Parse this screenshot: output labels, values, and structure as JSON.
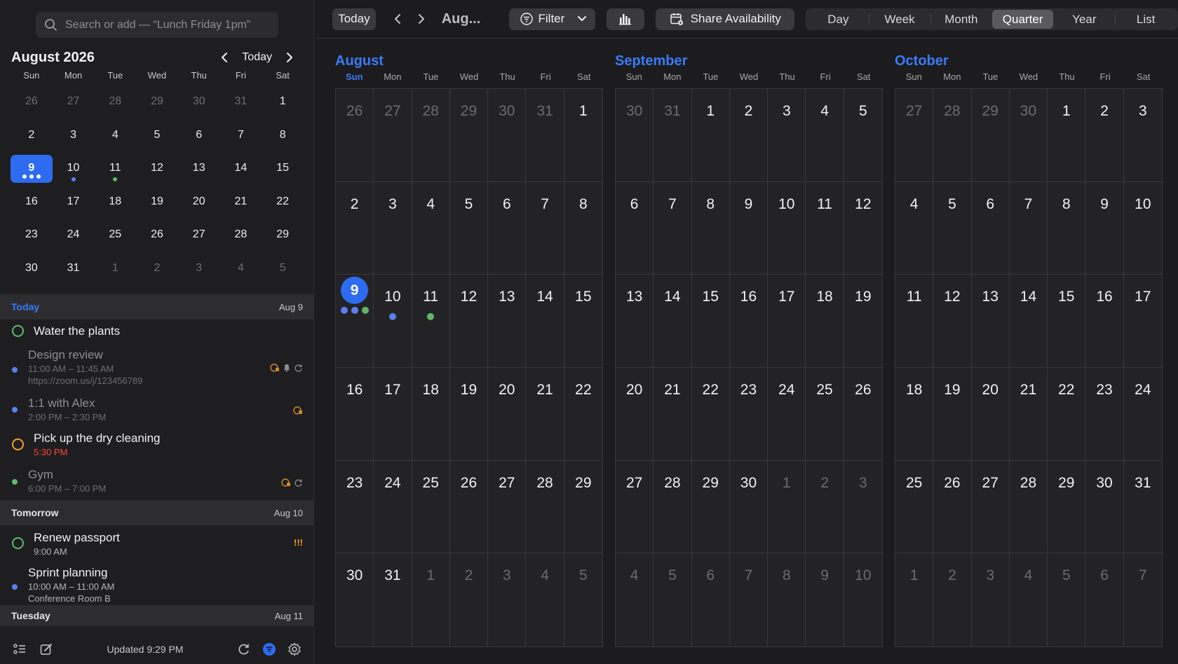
{
  "search": {
    "placeholder": "Search or add — “Lunch Friday 1pm”"
  },
  "mini": {
    "title": "August 2026",
    "today_label": "Today",
    "dow": [
      "Sun",
      "Mon",
      "Tue",
      "Wed",
      "Thu",
      "Fri",
      "Sat"
    ],
    "days": [
      {
        "n": "26",
        "muted": true
      },
      {
        "n": "27",
        "muted": true
      },
      {
        "n": "28",
        "muted": true
      },
      {
        "n": "29",
        "muted": true
      },
      {
        "n": "30",
        "muted": true
      },
      {
        "n": "31",
        "muted": true
      },
      {
        "n": "1"
      },
      {
        "n": "2"
      },
      {
        "n": "3"
      },
      {
        "n": "4"
      },
      {
        "n": "5"
      },
      {
        "n": "6"
      },
      {
        "n": "7"
      },
      {
        "n": "8"
      },
      {
        "n": "9",
        "selected": true,
        "dots": [
          "#ffffff",
          "#ffffff",
          "#ffffff"
        ]
      },
      {
        "n": "10",
        "dots": [
          "#5b7ff0"
        ]
      },
      {
        "n": "11",
        "dots": [
          "#5fb86a"
        ]
      },
      {
        "n": "12"
      },
      {
        "n": "13"
      },
      {
        "n": "14"
      },
      {
        "n": "15"
      },
      {
        "n": "16"
      },
      {
        "n": "17"
      },
      {
        "n": "18"
      },
      {
        "n": "19"
      },
      {
        "n": "20"
      },
      {
        "n": "21"
      },
      {
        "n": "22"
      },
      {
        "n": "23"
      },
      {
        "n": "24"
      },
      {
        "n": "25"
      },
      {
        "n": "26"
      },
      {
        "n": "27"
      },
      {
        "n": "28"
      },
      {
        "n": "29"
      },
      {
        "n": "30"
      },
      {
        "n": "31"
      },
      {
        "n": "1",
        "muted": true
      },
      {
        "n": "2",
        "muted": true
      },
      {
        "n": "3",
        "muted": true
      },
      {
        "n": "4",
        "muted": true
      },
      {
        "n": "5",
        "muted": true
      }
    ]
  },
  "agenda": {
    "sections": [
      {
        "label": "Today",
        "date": "Aug 9",
        "label_color": "#3a7bf7"
      },
      {
        "label": "Tomorrow",
        "date": "Aug 10",
        "label_color": "#f0f0f0"
      },
      {
        "label": "Tuesday",
        "date": "Aug 11",
        "label_color": "#f0f0f0"
      }
    ],
    "items": {
      "water": {
        "title": "Water the plants",
        "color": "#5fb86a"
      },
      "design": {
        "title": "Design review",
        "time": "11:00 AM – 11:45 AM",
        "link": "https://zoom.us/j/123456789",
        "color": "#5b7ff0"
      },
      "alex": {
        "title": "1:1 with Alex",
        "time": "2:00 PM – 2:30 PM",
        "color": "#5b7ff0"
      },
      "dry": {
        "title": "Pick up the dry cleaning",
        "time": "5:30 PM",
        "color": "#f0a030"
      },
      "gym": {
        "title": "Gym",
        "time": "6:00 PM – 7:00 PM",
        "color": "#5fb86a"
      },
      "passport": {
        "title": "Renew passport",
        "time": "9:00 AM",
        "priority": "!!!",
        "color": "#5fb86a"
      },
      "sprint": {
        "title": "Sprint planning",
        "time": "10:00 AM – 11:00 AM",
        "location": "Conference Room B",
        "color": "#5b7ff0"
      }
    }
  },
  "footer": {
    "updated": "Updated 9:29 PM"
  },
  "toolbar": {
    "today": "Today",
    "month": "Aug...",
    "filter": "Filter",
    "share": "Share Availability",
    "views": [
      "Day",
      "Week",
      "Month",
      "Quarter",
      "Year",
      "List"
    ],
    "active_view": "Quarter"
  },
  "quarter": [
    {
      "name": "August",
      "dow": [
        "Sun",
        "Mon",
        "Tue",
        "Wed",
        "Thu",
        "Fri",
        "Sat"
      ],
      "today_dow": 0,
      "days": [
        {
          "n": "26",
          "muted": true
        },
        {
          "n": "27",
          "muted": true
        },
        {
          "n": "28",
          "muted": true
        },
        {
          "n": "29",
          "muted": true
        },
        {
          "n": "30",
          "muted": true
        },
        {
          "n": "31",
          "muted": true
        },
        {
          "n": "1"
        },
        {
          "n": "2"
        },
        {
          "n": "3"
        },
        {
          "n": "4"
        },
        {
          "n": "5"
        },
        {
          "n": "6"
        },
        {
          "n": "7"
        },
        {
          "n": "8"
        },
        {
          "n": "9",
          "today": true,
          "dots": [
            "#5b7ff0",
            "#5b7ff0",
            "#5fb86a"
          ]
        },
        {
          "n": "10",
          "dots": [
            "#5b7ff0"
          ]
        },
        {
          "n": "11",
          "dots": [
            "#5fb86a"
          ]
        },
        {
          "n": "12"
        },
        {
          "n": "13"
        },
        {
          "n": "14"
        },
        {
          "n": "15"
        },
        {
          "n": "16"
        },
        {
          "n": "17"
        },
        {
          "n": "18"
        },
        {
          "n": "19"
        },
        {
          "n": "20"
        },
        {
          "n": "21"
        },
        {
          "n": "22"
        },
        {
          "n": "23"
        },
        {
          "n": "24"
        },
        {
          "n": "25"
        },
        {
          "n": "26"
        },
        {
          "n": "27"
        },
        {
          "n": "28"
        },
        {
          "n": "29"
        },
        {
          "n": "30"
        },
        {
          "n": "31"
        },
        {
          "n": "1",
          "muted": true
        },
        {
          "n": "2",
          "muted": true
        },
        {
          "n": "3",
          "muted": true
        },
        {
          "n": "4",
          "muted": true
        },
        {
          "n": "5",
          "muted": true
        }
      ]
    },
    {
      "name": "September",
      "dow": [
        "Sun",
        "Mon",
        "Tue",
        "Wed",
        "Thu",
        "Fri",
        "Sat"
      ],
      "today_dow": -1,
      "days": [
        {
          "n": "30",
          "muted": true
        },
        {
          "n": "31",
          "muted": true
        },
        {
          "n": "1"
        },
        {
          "n": "2"
        },
        {
          "n": "3"
        },
        {
          "n": "4"
        },
        {
          "n": "5"
        },
        {
          "n": "6"
        },
        {
          "n": "7"
        },
        {
          "n": "8"
        },
        {
          "n": "9"
        },
        {
          "n": "10"
        },
        {
          "n": "11"
        },
        {
          "n": "12"
        },
        {
          "n": "13"
        },
        {
          "n": "14"
        },
        {
          "n": "15"
        },
        {
          "n": "16"
        },
        {
          "n": "17"
        },
        {
          "n": "18"
        },
        {
          "n": "19"
        },
        {
          "n": "20"
        },
        {
          "n": "21"
        },
        {
          "n": "22"
        },
        {
          "n": "23"
        },
        {
          "n": "24"
        },
        {
          "n": "25"
        },
        {
          "n": "26"
        },
        {
          "n": "27"
        },
        {
          "n": "28"
        },
        {
          "n": "29"
        },
        {
          "n": "30"
        },
        {
          "n": "1",
          "muted": true
        },
        {
          "n": "2",
          "muted": true
        },
        {
          "n": "3",
          "muted": true
        },
        {
          "n": "4",
          "muted": true
        },
        {
          "n": "5",
          "muted": true
        },
        {
          "n": "6",
          "muted": true
        },
        {
          "n": "7",
          "muted": true
        },
        {
          "n": "8",
          "muted": true
        },
        {
          "n": "9",
          "muted": true
        },
        {
          "n": "10",
          "muted": true
        }
      ]
    },
    {
      "name": "October",
      "dow": [
        "Sun",
        "Mon",
        "Tue",
        "Wed",
        "Thu",
        "Fri",
        "Sat"
      ],
      "today_dow": -1,
      "days": [
        {
          "n": "27",
          "muted": true
        },
        {
          "n": "28",
          "muted": true
        },
        {
          "n": "29",
          "muted": true
        },
        {
          "n": "30",
          "muted": true
        },
        {
          "n": "1"
        },
        {
          "n": "2"
        },
        {
          "n": "3"
        },
        {
          "n": "4"
        },
        {
          "n": "5"
        },
        {
          "n": "6"
        },
        {
          "n": "7"
        },
        {
          "n": "8"
        },
        {
          "n": "9"
        },
        {
          "n": "10"
        },
        {
          "n": "11"
        },
        {
          "n": "12"
        },
        {
          "n": "13"
        },
        {
          "n": "14"
        },
        {
          "n": "15"
        },
        {
          "n": "16"
        },
        {
          "n": "17"
        },
        {
          "n": "18"
        },
        {
          "n": "19"
        },
        {
          "n": "20"
        },
        {
          "n": "21"
        },
        {
          "n": "22"
        },
        {
          "n": "23"
        },
        {
          "n": "24"
        },
        {
          "n": "25"
        },
        {
          "n": "26"
        },
        {
          "n": "27"
        },
        {
          "n": "28"
        },
        {
          "n": "29"
        },
        {
          "n": "30"
        },
        {
          "n": "31"
        },
        {
          "n": "1",
          "muted": true
        },
        {
          "n": "2",
          "muted": true
        },
        {
          "n": "3",
          "muted": true
        },
        {
          "n": "4",
          "muted": true
        },
        {
          "n": "5",
          "muted": true
        },
        {
          "n": "6",
          "muted": true
        },
        {
          "n": "7",
          "muted": true
        }
      ]
    }
  ]
}
